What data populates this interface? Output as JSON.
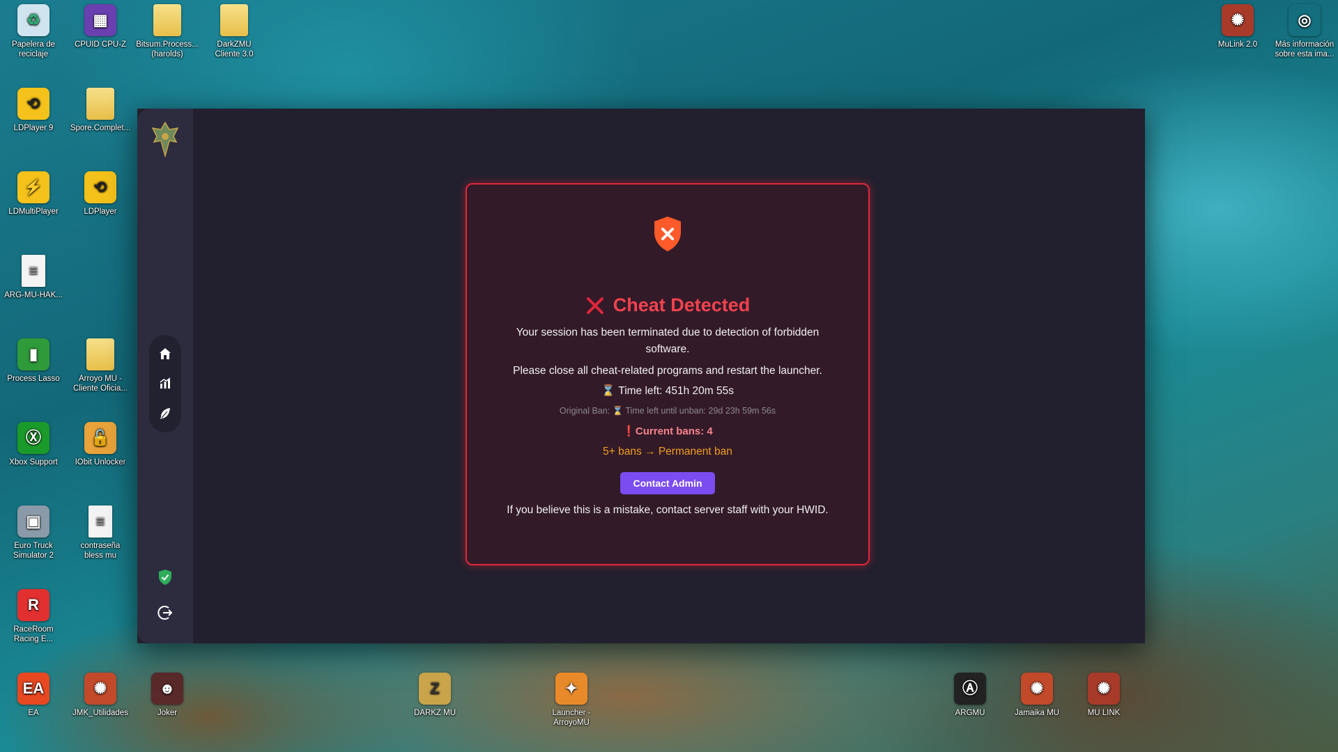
{
  "desktop": {
    "icons_left": [
      {
        "label": "Papelera de reciclaje",
        "icon": "recycle-bin-icon"
      },
      {
        "label": "CPUID CPU-Z",
        "icon": "cpu-z-icon"
      },
      {
        "label": "Bitsum.Process... (harolds)",
        "icon": "folder-icon"
      },
      {
        "label": "DarkZMU Cliente 3.0",
        "icon": "folder-icon"
      },
      {
        "label": "LDPlayer 9",
        "icon": "ldplayer-icon"
      },
      {
        "label": "Spore.Complet...",
        "icon": "folder-icon"
      },
      {
        "label": "LDMultiPlayer",
        "icon": "ldmultiplayer-icon"
      },
      {
        "label": "LDPlayer",
        "icon": "ldplayer-icon"
      },
      {
        "label": "ARG-MU-HAK...",
        "icon": "document-icon"
      },
      {
        "label": "Process Lasso",
        "icon": "process-lasso-icon"
      },
      {
        "label": "Arroyo MU - Cliente Oficia...",
        "icon": "folder-icon"
      },
      {
        "label": "Xbox Support",
        "icon": "xbox-icon"
      },
      {
        "label": "IObit Unlocker",
        "icon": "iobit-unlocker-icon"
      },
      {
        "label": "Euro Truck Simulator 2",
        "icon": "truck-icon"
      },
      {
        "label": "contraseña bless mu",
        "icon": "document-icon"
      },
      {
        "label": "RaceRoom Racing E...",
        "icon": "raceroom-icon"
      },
      {
        "label": "EA",
        "icon": "ea-icon"
      },
      {
        "label": "JMK_Utilidades",
        "icon": "jamaika-icon"
      },
      {
        "label": "Joker",
        "icon": "joker-icon"
      }
    ],
    "icons_bottom": [
      {
        "label": "DARKZ MU",
        "icon": "darkz-mu-icon"
      },
      {
        "label": "Launcher - ArroyoMU",
        "icon": "arroyomu-launcher-icon"
      },
      {
        "label": "ARGMU",
        "icon": "argmu-icon"
      },
      {
        "label": "Jamaika MU",
        "icon": "jamaika-icon"
      },
      {
        "label": "MU LINK",
        "icon": "mu-link-icon"
      }
    ],
    "icons_right": [
      {
        "label": "MuLink 2.0",
        "icon": "mulink-icon"
      },
      {
        "label": "Más información sobre esta ima...",
        "icon": "info-camera-icon"
      }
    ]
  },
  "modal": {
    "title": "Cheat Detected",
    "message": "Your session has been terminated due to detection of forbidden software.",
    "message2": "Please close all cheat-related programs and restart the launcher.",
    "time_left": "Time left: 451h 20m 55s",
    "original_ban": "Original Ban: ⌛ Time left until unban: 29d 23h 59m 56s",
    "current_bans": "Current bans: 4",
    "permanent": "5+ bans → Permanent ban",
    "contact_button": "Contact Admin",
    "hwid_note": "If you believe this is a mistake, contact server staff with your HWID.",
    "accent": "#e0263a"
  }
}
